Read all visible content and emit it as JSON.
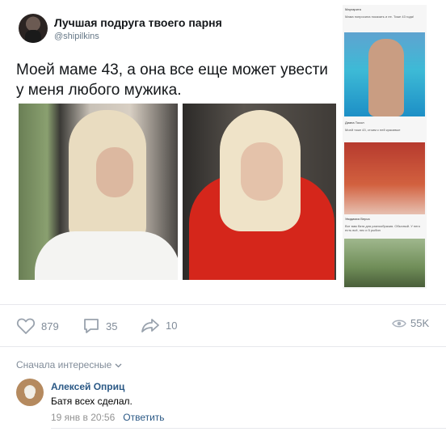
{
  "tweet": {
    "author_name": "Лучшая подруга твоего парня",
    "author_handle": "@shipilkins",
    "text": "Моей маме 43, а она все еще может увести у меня любого мужика."
  },
  "stats": {
    "likes": "879",
    "comments": "35",
    "shares": "10",
    "views": "55K"
  },
  "comments_section": {
    "sort_label": "Сначала интересные",
    "items": [
      {
        "author": "Алексей Оприц",
        "text": "Батя всех сделал.",
        "date": "19 янв в 20:56",
        "reply_label": "Ответить"
      }
    ]
  },
  "side_tiles": [
    {
      "header": "Маргарита",
      "text": "Мама попросила показать и ее. Тоже 43 года!"
    },
    {
      "header": "Диана Тосол",
      "text": "Моей тоже 43, стоим с ней красивые"
    },
    {
      "header": "Увидимся Верса",
      "text": "Вот вам батя для разнообразия. Обычный. У него есть всё, пес и 5 рыбин"
    }
  ],
  "colors": {
    "link": "#2a5885",
    "meta": "#818c99",
    "divider": "#e7e8ec"
  }
}
